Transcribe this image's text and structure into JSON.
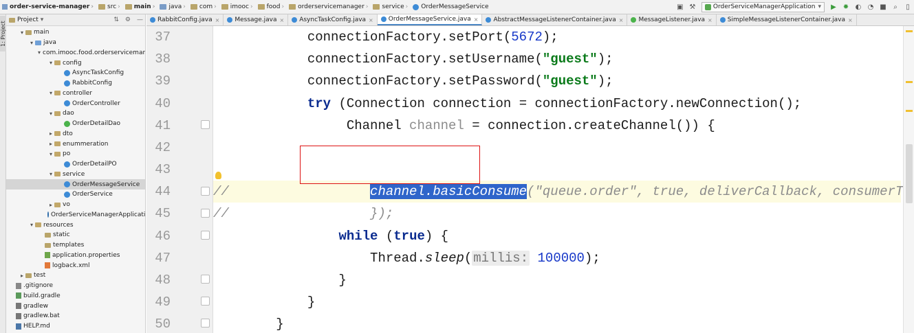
{
  "breadcrumb": [
    {
      "label": "order-service-manager",
      "icon": "module-icon",
      "bold": true
    },
    {
      "label": "src",
      "icon": "folder-icon"
    },
    {
      "label": "main",
      "icon": "folder-icon",
      "bold": true
    },
    {
      "label": "java",
      "icon": "source-folder-icon"
    },
    {
      "label": "com",
      "icon": "package-icon"
    },
    {
      "label": "imooc",
      "icon": "package-icon"
    },
    {
      "label": "food",
      "icon": "package-icon"
    },
    {
      "label": "orderservicemanager",
      "icon": "package-icon"
    },
    {
      "label": "service",
      "icon": "package-icon"
    },
    {
      "label": "OrderMessageService",
      "icon": "class-icon"
    }
  ],
  "run_config": {
    "label": "OrderServiceManagerApplication"
  },
  "sidebar_tab": {
    "label": "1: Project"
  },
  "project_panel": {
    "title": "Project",
    "tree": [
      {
        "label": "main",
        "indent": 1,
        "arrow": "down",
        "icon": "folder"
      },
      {
        "label": "java",
        "indent": 2,
        "arrow": "down",
        "icon": "src"
      },
      {
        "label": "com.imooc.food.orderservicemanager",
        "indent": 3,
        "arrow": "down",
        "icon": "pkg"
      },
      {
        "label": "config",
        "indent": 4,
        "arrow": "down",
        "icon": "pkg"
      },
      {
        "label": "AsyncTaskConfig",
        "indent": 5,
        "arrow": "",
        "icon": "class"
      },
      {
        "label": "RabbitConfig",
        "indent": 5,
        "arrow": "",
        "icon": "class"
      },
      {
        "label": "controller",
        "indent": 4,
        "arrow": "down",
        "icon": "pkg"
      },
      {
        "label": "OrderController",
        "indent": 5,
        "arrow": "",
        "icon": "class"
      },
      {
        "label": "dao",
        "indent": 4,
        "arrow": "down",
        "icon": "pkg"
      },
      {
        "label": "OrderDetailDao",
        "indent": 5,
        "arrow": "",
        "icon": "iface"
      },
      {
        "label": "dto",
        "indent": 4,
        "arrow": "right",
        "icon": "pkg"
      },
      {
        "label": "enummeration",
        "indent": 4,
        "arrow": "right",
        "icon": "pkg"
      },
      {
        "label": "po",
        "indent": 4,
        "arrow": "down",
        "icon": "pkg"
      },
      {
        "label": "OrderDetailPO",
        "indent": 5,
        "arrow": "",
        "icon": "class"
      },
      {
        "label": "service",
        "indent": 4,
        "arrow": "down",
        "icon": "pkg"
      },
      {
        "label": "OrderMessageService",
        "indent": 5,
        "arrow": "",
        "icon": "class",
        "selected": true
      },
      {
        "label": "OrderService",
        "indent": 5,
        "arrow": "",
        "icon": "class"
      },
      {
        "label": "vo",
        "indent": 4,
        "arrow": "right",
        "icon": "pkg"
      },
      {
        "label": "OrderServiceManagerApplication",
        "indent": 4,
        "arrow": "",
        "icon": "app"
      },
      {
        "label": "resources",
        "indent": 2,
        "arrow": "down",
        "icon": "res"
      },
      {
        "label": "static",
        "indent": 3,
        "arrow": "",
        "icon": "folder"
      },
      {
        "label": "templates",
        "indent": 3,
        "arrow": "",
        "icon": "folder"
      },
      {
        "label": "application.properties",
        "indent": 3,
        "arrow": "",
        "icon": "prop"
      },
      {
        "label": "logback.xml",
        "indent": 3,
        "arrow": "",
        "icon": "xml"
      },
      {
        "label": "test",
        "indent": 1,
        "arrow": "right",
        "icon": "folder"
      },
      {
        "label": ".gitignore",
        "indent": 0,
        "arrow": "",
        "icon": "git"
      },
      {
        "label": "build.gradle",
        "indent": 0,
        "arrow": "",
        "icon": "grad"
      },
      {
        "label": "gradlew",
        "indent": 0,
        "arrow": "",
        "icon": "bat"
      },
      {
        "label": "gradlew.bat",
        "indent": 0,
        "arrow": "",
        "icon": "bat"
      },
      {
        "label": "HELP.md",
        "indent": 0,
        "arrow": "",
        "icon": "md"
      }
    ]
  },
  "tabs": [
    {
      "label": "RabbitConfig.java",
      "icon": "class"
    },
    {
      "label": "Message.java",
      "icon": "class"
    },
    {
      "label": "AsyncTaskConfig.java",
      "icon": "class"
    },
    {
      "label": "OrderMessageService.java",
      "icon": "class",
      "active": true
    },
    {
      "label": "AbstractMessageListenerContainer.java",
      "icon": "class"
    },
    {
      "label": "MessageListener.java",
      "icon": "iface"
    },
    {
      "label": "SimpleMessageListenerContainer.java",
      "icon": "class"
    }
  ],
  "editor": {
    "line_numbers": [
      "37",
      "38",
      "39",
      "40",
      "41",
      "42",
      "43",
      "44",
      "45",
      "46",
      "47",
      "48",
      "49",
      "50"
    ],
    "lines": {
      "l37": {
        "t1": "            connectionFactory.setPort(",
        "n": "5672",
        "t2": ");"
      },
      "l38": {
        "t1": "            connectionFactory.setUsername(",
        "s": "\"guest\"",
        "t2": ");"
      },
      "l39": {
        "t1": "            connectionFactory.setPassword(",
        "s": "\"guest\"",
        "t2": ");"
      },
      "l40": {
        "t0": "            ",
        "kw": "try",
        "t1": " (Connection connection = connectionFactory.newConnection();"
      },
      "l41": {
        "t1": "                 Channel ",
        "g": "channel",
        "t2": " = connection.createChannel()) {"
      },
      "l44": {
        "c1": "//",
        "t0": "                  ",
        "sel": "channel.basicConsume",
        "c2": "(\"queue.order\", true, deliverCallback, consumerTag -> {"
      },
      "l45": {
        "c1": "//",
        "c2": "                  });"
      },
      "l46": {
        "t0": "                ",
        "kw": "while",
        "t1": " (",
        "kw2": "true",
        "t2": ") {"
      },
      "l47": {
        "t0": "                    Thread.",
        "it": "sleep",
        "t1": "(",
        "hint": "millis:",
        "n": " 100000",
        "t2": ");"
      },
      "l48": {
        "t1": "                }"
      },
      "l49": {
        "t1": "            }"
      },
      "l50": {
        "t1": "        }"
      }
    }
  }
}
